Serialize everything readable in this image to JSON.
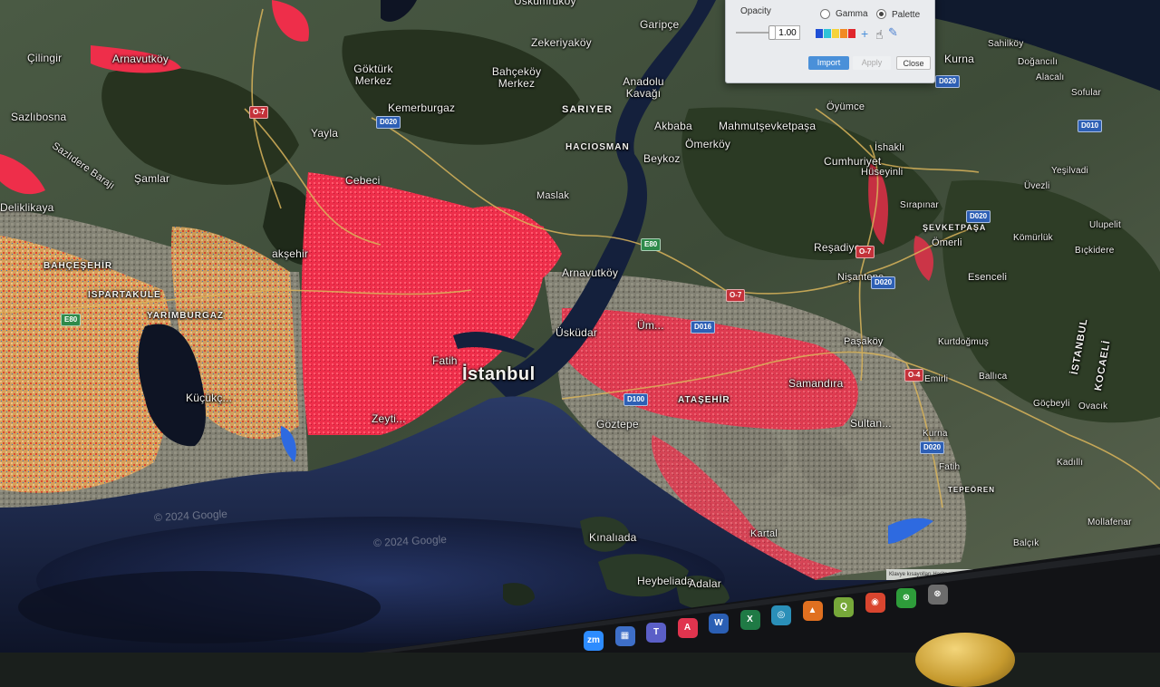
{
  "map": {
    "city_label": "İstanbul",
    "places": {
      "uskumrukoy": "Uskumruköy",
      "garipce": "Garipçe",
      "cilingir": "Çilingir",
      "arnavutkoy_n": "Arnavutköy",
      "zekeriyakoy": "Zekeriyaköy",
      "bahcekoy": "Bahçeköy Merkez",
      "anadolu_kavagi": "Anadolu Kavağı",
      "kurna": "Kurna",
      "sahilkoy": "Sahilköy",
      "dogancili": "Doğancılı",
      "alacali": "Alacalı",
      "goktürk": "Göktürk Merkez",
      "kemerburgaz": "Kemerburgaz",
      "sariyer": "SARIYER",
      "akbaba": "Akbaba",
      "mahmutsevketpasa": "Mahmutşevketpaşa",
      "oyumce": "Öyümce",
      "sofular": "Sofular",
      "sazlibosna": "Sazlıbosna",
      "yayla": "Yayla",
      "haciosman": "HACIOSMAN",
      "omerkoy": "Ömerköy",
      "ishakli": "İshaklı",
      "samlar": "Şamlar",
      "cebeci": "Cebeci",
      "beykoz": "Beykoz",
      "cumhuriyet": "Cumhuriyet",
      "huseyinli": "Hüseyinli",
      "yesilvadi": "Yeşilvadi",
      "uvezli": "Üvezli",
      "sazlidere": "Sazlıdere Barajı",
      "delikliкaya": "Deliklikaya",
      "maslak": "Maslak",
      "sirapinar": "Sırapınar",
      "sevketpasa": "ŞEVKETPAŞA",
      "ulupelit": "Ulupelit",
      "komurluk": "Kömürlük",
      "bickidere": "Bıçkidere",
      "resadiye": "Reşadiye",
      "omerli": "Ömerli",
      "aksehir": "akşehir",
      "bahcesehir": "BAHÇEŞEHİR",
      "arnavutkoy_s": "Arnavutköy",
      "esenceli": "Esenceli",
      "ispartakule": "ISPARTAKULE",
      "nisantepe": "Nişantepe",
      "yarimburgaz": "YARIMBURGAZ",
      "umraniye": "Üm...",
      "uskudar": "Üsküdar",
      "pasakoy": "Paşaköy",
      "kurtdogmus": "Kurtdoğmuş",
      "istanbul_vert": "İSTANBUL",
      "kocaeli_vert": "KOCAELİ",
      "kucukcekmece": "Küçükç...",
      "atasehir": "ATAŞEHİR",
      "samandira": "Samandıra",
      "emirli": "Emirli",
      "ballica": "Ballıca",
      "gocbeyli": "Göçbeyli",
      "ovacik": "Ovacık",
      "goztepe": "Göztepe",
      "sultanbeyli": "Sultan...",
      "kurna_s": "Kurna",
      "fatih": "Fatih",
      "kadikoy_lbl": "Kadıllı",
      "tepeoren": "TEPEÖREN",
      "mollafenar": "Mollafenar",
      "balcik": "Balçık",
      "kinaliada": "Kınalıada",
      "heybeliada": "Heybeliada",
      "adalar": "Adalar",
      "kartal": "Kartal",
      "zeytinburnu": "Zeyti...",
      "fatih_c": "Fatih"
    },
    "shields": {
      "o7a": "O-7",
      "d020a": "D020",
      "d020b": "D020",
      "d020c": "D020",
      "d020d": "D020",
      "d020e": "D020",
      "o7b": "O-7",
      "o7c": "O-7",
      "e80a": "E80",
      "e80b": "E80",
      "d100": "D100",
      "d016": "D016",
      "o4": "O-4",
      "d010": "D010"
    },
    "watermark_1": "© 2024 Google",
    "watermark_2": "© 2024 Google",
    "attribution": "Klavye kısayolları   Harita verileri ©2024 Görüntü ©2024 TerraMetrics   2 km"
  },
  "dialog": {
    "opacity_label": "Opacity",
    "opacity_value": "1.00",
    "gamma_label": "Gamma",
    "palette_label": "Palette",
    "selected_mode": "Palette",
    "palette_colors": [
      "#1f4fd6",
      "#2fc3d8",
      "#f6d33a",
      "#f28a22",
      "#e0262c"
    ],
    "import_label": "Import",
    "apply_label": "Apply",
    "close_label": "Close"
  },
  "taskbar": {
    "icons": [
      {
        "name": "Zoom",
        "glyph": "zm",
        "color": "#2d8cff"
      },
      {
        "name": "Calendar",
        "glyph": "▦",
        "color": "#3e6fc8"
      },
      {
        "name": "Teams",
        "glyph": "T",
        "color": "#5b5fc7"
      },
      {
        "name": "Acrobat",
        "glyph": "A",
        "color": "#e0344e"
      },
      {
        "name": "Word",
        "glyph": "W",
        "color": "#2b5fb4"
      },
      {
        "name": "Excel",
        "glyph": "X",
        "color": "#1f7a45"
      },
      {
        "name": "Maps",
        "glyph": "◎",
        "color": "#2a8fb8"
      },
      {
        "name": "ArcGIS",
        "glyph": "▲",
        "color": "#e07020"
      },
      {
        "name": "QGIS",
        "glyph": "Q",
        "color": "#77a83a"
      },
      {
        "name": "Chrome",
        "glyph": "◉",
        "color": "#d9452f"
      },
      {
        "name": "Xbox",
        "glyph": "⊗",
        "color": "#2e9c3a"
      },
      {
        "name": "Extra",
        "glyph": "⊗",
        "color": "#6c6c6c"
      }
    ]
  }
}
